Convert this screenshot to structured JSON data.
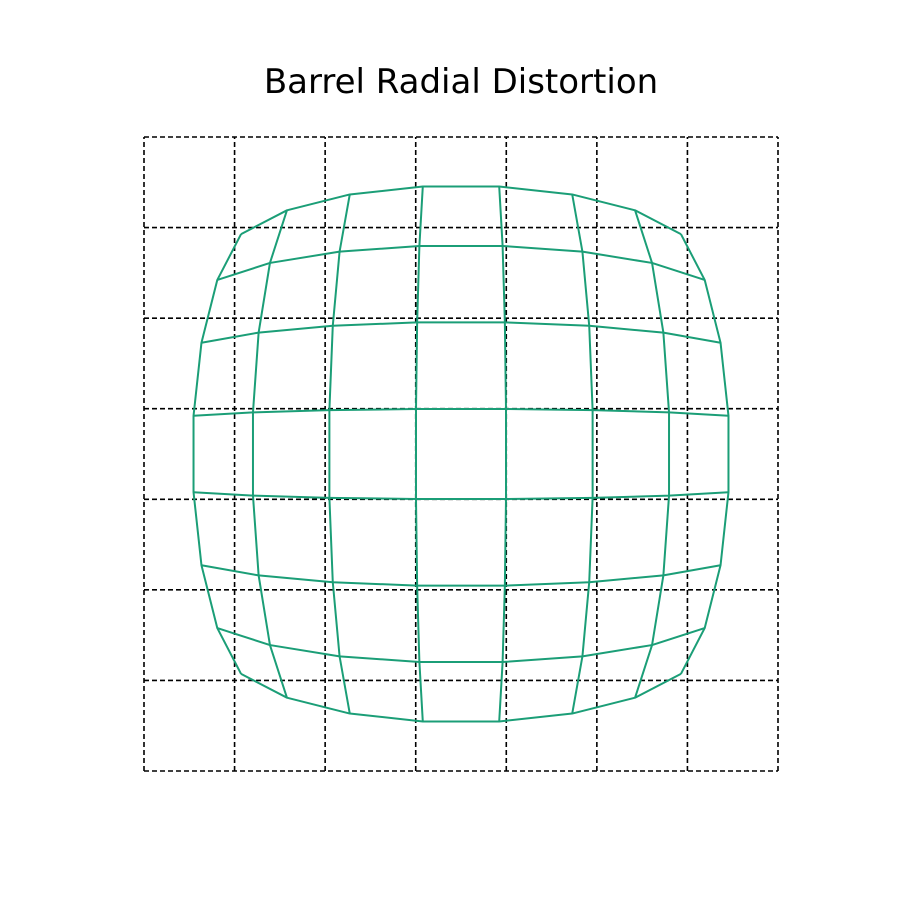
{
  "chart_data": {
    "type": "line",
    "title": "Barrel Radial Distortion",
    "xlabel": "",
    "ylabel": "",
    "axes_visible": false,
    "xlim": [
      -3.5,
      3.5
    ],
    "ylim": [
      -3.5,
      3.5
    ],
    "grid_lines": [
      -3.5,
      -2.5,
      -1.5,
      -0.5,
      0.5,
      1.5,
      2.5,
      3.5
    ],
    "distortion": {
      "kind": "barrel",
      "k": 0.0125
    },
    "series": [
      {
        "role": "undistorted-grid",
        "color": "#000000",
        "linestyle": "dashed"
      },
      {
        "role": "distorted-grid",
        "color": "#1b9e77",
        "linestyle": "solid"
      }
    ]
  }
}
